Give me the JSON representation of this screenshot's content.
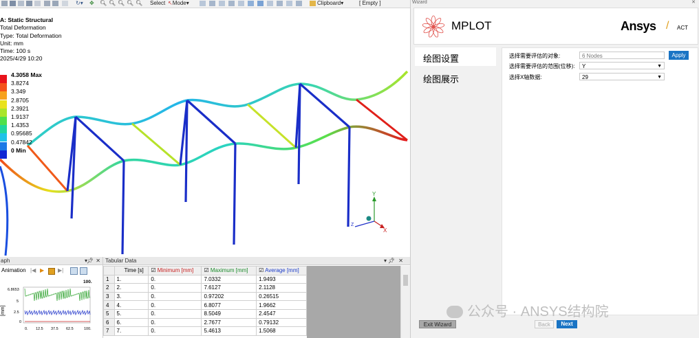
{
  "toolbar": {
    "select_label": "Select",
    "mode_label": "Mode",
    "clipboard_label": "Clipboard",
    "empty_label": "[ Empty ]"
  },
  "result_info": {
    "title": "A: Static Structural",
    "result": "Total Deformation",
    "type": "Type: Total Deformation",
    "unit": "Unit: mm",
    "time": "Time: 100 s",
    "date": "2025/4/29 10:20"
  },
  "legend": {
    "items": [
      {
        "label": "4.3058 Max",
        "color": "#e8131b"
      },
      {
        "label": "3.8274",
        "color": "#f5531b"
      },
      {
        "label": "3.349",
        "color": "#f7a21e"
      },
      {
        "label": "2.8705",
        "color": "#e9e21c"
      },
      {
        "label": "2.3921",
        "color": "#a9e52a"
      },
      {
        "label": "1.9137",
        "color": "#4fe04b"
      },
      {
        "label": "1.4353",
        "color": "#20d69e"
      },
      {
        "label": "0.95685",
        "color": "#1ec2e8"
      },
      {
        "label": "0.47842",
        "color": "#1a79e6"
      },
      {
        "label": "0 Min",
        "color": "#1227d4"
      }
    ]
  },
  "triad": {
    "x": "X",
    "y": "Y",
    "z": "Z"
  },
  "graph_pane": {
    "title": "aph",
    "animation_label": "Animation",
    "y_max": "6.8653",
    "y_mid": "5",
    "y_low": "2.5",
    "y_min": "0",
    "y_unit": "[mm]",
    "x_ticks": [
      "0.",
      "12.5",
      "37.5",
      "62.5",
      "100."
    ],
    "x_max_label": "100."
  },
  "tabular": {
    "title": "Tabular Data",
    "columns": [
      "Time [s]",
      "Minimum [mm]",
      "Maximum [mm]",
      "Average [mm]"
    ],
    "rows": [
      [
        "1",
        "1.",
        "0.",
        "7.0332",
        "1.9493"
      ],
      [
        "2",
        "2.",
        "0.",
        "7.6127",
        "2.1128"
      ],
      [
        "3",
        "3.",
        "0.",
        "0.97202",
        "0.26515"
      ],
      [
        "4",
        "4.",
        "0.",
        "6.8077",
        "1.9662"
      ],
      [
        "5",
        "5.",
        "0.",
        "8.5049",
        "2.4547"
      ],
      [
        "6",
        "6.",
        "0.",
        "2.7677",
        "0.79132"
      ],
      [
        "7",
        "7.",
        "0.",
        "5.4613",
        "1.5068"
      ]
    ]
  },
  "wizard": {
    "title": "Wizard",
    "app_name": "MPLOT",
    "brand": "Ansys",
    "brand_suffix": "ACT",
    "nav": [
      "绘图设置",
      "绘图展示"
    ],
    "fields": [
      {
        "label": "选择需要评估的对象:",
        "value": "6 Nodes"
      },
      {
        "label": "选择需要评估的范围(位移):",
        "value": "Y"
      },
      {
        "label": "选择X轴数据:",
        "value": "29"
      }
    ],
    "apply_label": "Apply",
    "exit_label": "Exit Wizard",
    "back_label": "Back",
    "next_label": "Next",
    "watermark": "公众号 · ANSYS结构院"
  },
  "colors": {
    "accent": "#1a74c4",
    "panel": "#f1f1f1"
  }
}
